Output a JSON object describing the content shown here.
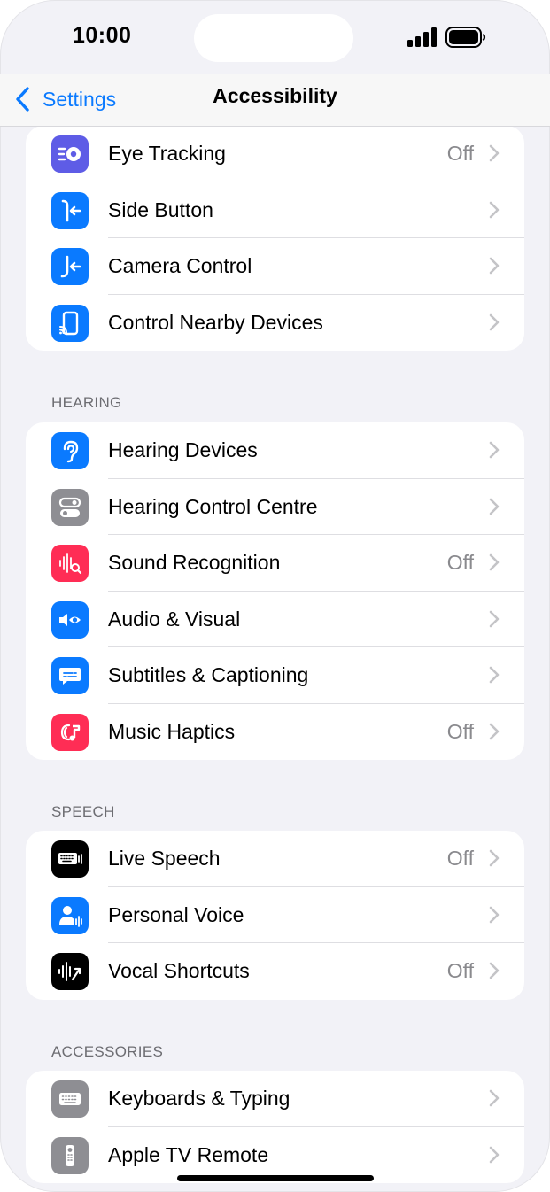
{
  "status": {
    "time": "10:00"
  },
  "nav": {
    "back_label": "Settings",
    "title": "Accessibility"
  },
  "group_top": [
    {
      "label": "Eye Tracking",
      "value": "Off",
      "icon": "eye-tracking-icon",
      "color": "#5e5ce6"
    },
    {
      "label": "Side Button",
      "value": "",
      "icon": "side-button-icon",
      "color": "#0a7aff"
    },
    {
      "label": "Camera Control",
      "value": "",
      "icon": "camera-control-icon",
      "color": "#0a7aff"
    },
    {
      "label": "Control Nearby Devices",
      "value": "",
      "icon": "nearby-devices-icon",
      "color": "#0a7aff"
    }
  ],
  "hearing": {
    "header": "HEARING",
    "items": [
      {
        "label": "Hearing Devices",
        "value": "",
        "icon": "ear-icon",
        "color": "#0a7aff"
      },
      {
        "label": "Hearing Control Centre",
        "value": "",
        "icon": "toggles-icon",
        "color": "#8e8e93"
      },
      {
        "label": "Sound Recognition",
        "value": "Off",
        "icon": "sound-recognition-icon",
        "color": "#ff2d55"
      },
      {
        "label": "Audio & Visual",
        "value": "",
        "icon": "audio-visual-icon",
        "color": "#0a7aff"
      },
      {
        "label": "Subtitles & Captioning",
        "value": "",
        "icon": "captions-icon",
        "color": "#0a7aff"
      },
      {
        "label": "Music Haptics",
        "value": "Off",
        "icon": "music-haptics-icon",
        "color": "#ff2d55"
      }
    ]
  },
  "speech": {
    "header": "SPEECH",
    "items": [
      {
        "label": "Live Speech",
        "value": "Off",
        "icon": "keyboard-wave-icon",
        "color": "#000000"
      },
      {
        "label": "Personal Voice",
        "value": "",
        "icon": "person-wave-icon",
        "color": "#0a7aff"
      },
      {
        "label": "Vocal Shortcuts",
        "value": "Off",
        "icon": "waveform-arrow-icon",
        "color": "#000000"
      }
    ]
  },
  "accessories": {
    "header": "ACCESSORIES",
    "items": [
      {
        "label": "Keyboards & Typing",
        "value": "",
        "icon": "keyboard-icon",
        "color": "#8e8e93"
      },
      {
        "label": "Apple TV Remote",
        "value": "",
        "icon": "remote-icon",
        "color": "#8e8e93"
      }
    ]
  }
}
